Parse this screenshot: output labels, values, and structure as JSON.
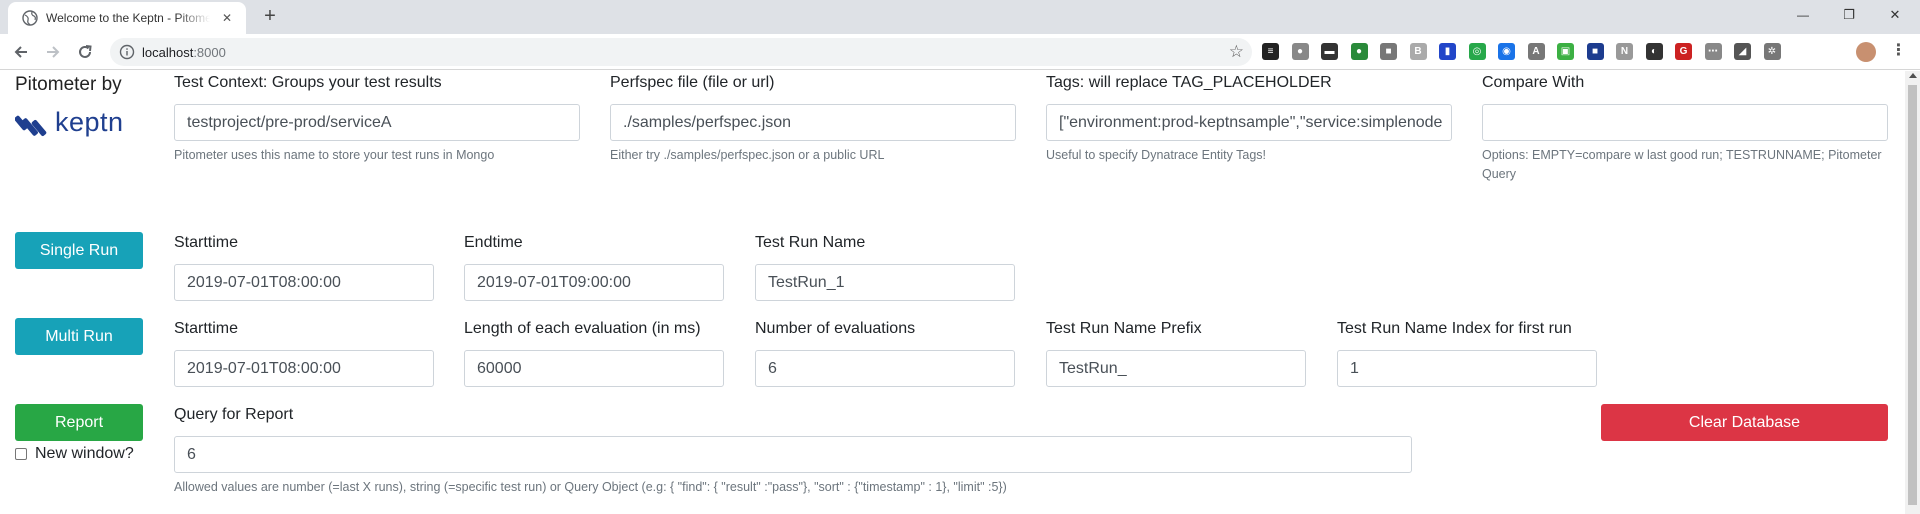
{
  "browser": {
    "tab_title": "Welcome to the Keptn - Pitometer",
    "tab_close": "✕",
    "new_tab": "+",
    "window_minimize": "—",
    "window_restore": "❐",
    "window_close": "✕",
    "url_host": "localhost",
    "url_port": ":8000",
    "extension_icons": [
      "layers-icon",
      "circle-icon",
      "toggle-icon",
      "grammarly-icon",
      "box-icon",
      "b-icon",
      "bookmark-icon",
      "react-icon",
      "spinner-icon",
      "a-icon",
      "camera-icon",
      "green-box-icon",
      "news-icon",
      "globe-icon",
      "g-icon",
      "dots-icon",
      "puzzle-icon",
      "gear-icon"
    ]
  },
  "brand": {
    "title": "Pitometer by",
    "logo_text": "keptn",
    "logo_color": "#1f3f8f"
  },
  "config": {
    "test_context": {
      "label": "Test Context: Groups your test results",
      "value": "testproject/pre-prod/serviceA",
      "help": "Pitometer uses this name to store your test runs in Mongo"
    },
    "perfspec": {
      "label": "Perfspec file (file or url)",
      "value": "./samples/perfspec.json",
      "help": "Either try ./samples/perfspec.json or a public URL"
    },
    "tags": {
      "label": "Tags: will replace TAG_PLACEHOLDER",
      "value": "[\"environment:prod-keptnsample\",\"service:simplenode",
      "help": "Useful to specify Dynatrace Entity Tags!"
    },
    "compare_with": {
      "label": "Compare With",
      "value": "",
      "help": "Options: EMPTY=compare w last good run; TESTRUNNAME; Pitometer Query"
    }
  },
  "single_run": {
    "button": "Single Run",
    "starttime_label": "Starttime",
    "starttime": "2019-07-01T08:00:00",
    "endtime_label": "Endtime",
    "endtime": "2019-07-01T09:00:00",
    "name_label": "Test Run Name",
    "name": "TestRun_1"
  },
  "multi_run": {
    "button": "Multi Run",
    "starttime_label": "Starttime",
    "starttime": "2019-07-01T08:00:00",
    "length_label": "Length of each evaluation (in ms)",
    "length": "60000",
    "count_label": "Number of evaluations",
    "count": "6",
    "prefix_label": "Test Run Name Prefix",
    "prefix": "TestRun_",
    "index_label": "Test Run Name Index for first run",
    "index": "1"
  },
  "report": {
    "button": "Report",
    "new_window_label": "New window?",
    "query_label": "Query for Report",
    "query": "6",
    "help": "Allowed values are number (=last X runs), string (=specific test run) or Query Object (e.g: { \"find\": { \"result\" :\"pass\"}, \"sort\" : {\"timestamp\" : 1}, \"limit\" :5})",
    "clear_button": "Clear Database"
  },
  "colors": {
    "info": "#17a2b8",
    "success": "#28a745",
    "danger": "#dc3545"
  }
}
